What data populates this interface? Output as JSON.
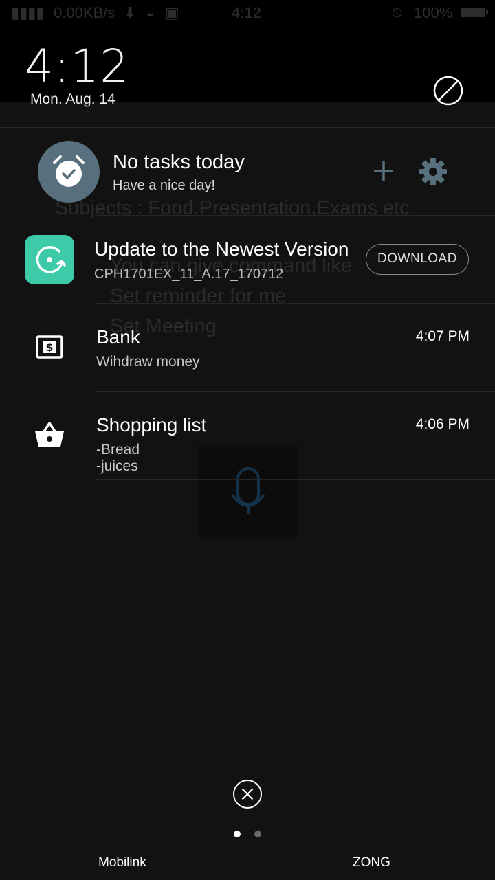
{
  "status_bar": {
    "network_speed": "0.00KB/s",
    "time": "4:12",
    "battery": "100%"
  },
  "header": {
    "clock": "4:12",
    "date": "Mon. Aug. 14"
  },
  "background_app": {
    "line1": "Subjects : Food,Presentation,Exams etc",
    "line2": "You can give command like",
    "line3": "Set reminder for me",
    "line4": "Set Meeting"
  },
  "task_card": {
    "title": "No tasks today",
    "subtitle": "Have a nice day!",
    "icon": "alarm-check-icon"
  },
  "update_notification": {
    "title": "Update to the Newest Version",
    "subtitle": "CPH1701EX_11_A.17_170712",
    "button_label": "DOWNLOAD",
    "icon_color": "#3ccaa8"
  },
  "notes": [
    {
      "title": "Bank",
      "body": [
        "Wihdraw money"
      ],
      "time": "4:07 PM",
      "icon": "money-icon"
    },
    {
      "title": "Shopping list",
      "body": [
        "-Bread",
        "-juices"
      ],
      "time": "4:06 PM",
      "icon": "basket-icon"
    }
  ],
  "pager": {
    "active_page": 1,
    "page_count": 2
  },
  "carriers": [
    "Mobilink",
    "ZONG"
  ],
  "colors": {
    "accent": "#58707d",
    "background": "#121212"
  }
}
